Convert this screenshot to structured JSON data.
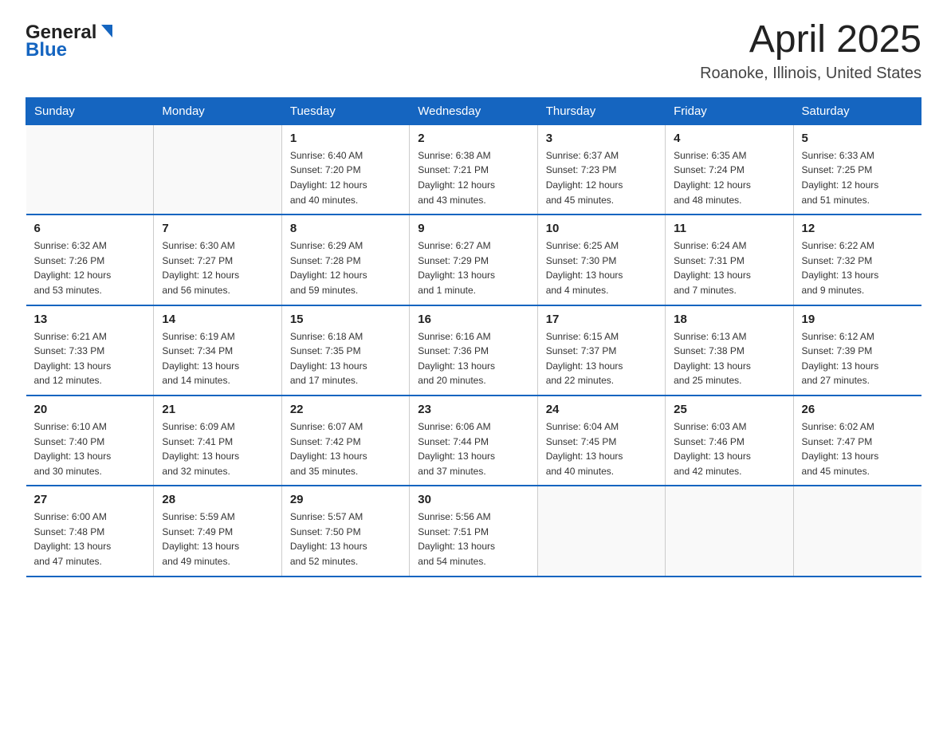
{
  "logo": {
    "general": "General",
    "blue": "Blue"
  },
  "title": "April 2025",
  "location": "Roanoke, Illinois, United States",
  "days_of_week": [
    "Sunday",
    "Monday",
    "Tuesday",
    "Wednesday",
    "Thursday",
    "Friday",
    "Saturday"
  ],
  "weeks": [
    [
      {
        "day": "",
        "info": ""
      },
      {
        "day": "",
        "info": ""
      },
      {
        "day": "1",
        "info": "Sunrise: 6:40 AM\nSunset: 7:20 PM\nDaylight: 12 hours\nand 40 minutes."
      },
      {
        "day": "2",
        "info": "Sunrise: 6:38 AM\nSunset: 7:21 PM\nDaylight: 12 hours\nand 43 minutes."
      },
      {
        "day": "3",
        "info": "Sunrise: 6:37 AM\nSunset: 7:23 PM\nDaylight: 12 hours\nand 45 minutes."
      },
      {
        "day": "4",
        "info": "Sunrise: 6:35 AM\nSunset: 7:24 PM\nDaylight: 12 hours\nand 48 minutes."
      },
      {
        "day": "5",
        "info": "Sunrise: 6:33 AM\nSunset: 7:25 PM\nDaylight: 12 hours\nand 51 minutes."
      }
    ],
    [
      {
        "day": "6",
        "info": "Sunrise: 6:32 AM\nSunset: 7:26 PM\nDaylight: 12 hours\nand 53 minutes."
      },
      {
        "day": "7",
        "info": "Sunrise: 6:30 AM\nSunset: 7:27 PM\nDaylight: 12 hours\nand 56 minutes."
      },
      {
        "day": "8",
        "info": "Sunrise: 6:29 AM\nSunset: 7:28 PM\nDaylight: 12 hours\nand 59 minutes."
      },
      {
        "day": "9",
        "info": "Sunrise: 6:27 AM\nSunset: 7:29 PM\nDaylight: 13 hours\nand 1 minute."
      },
      {
        "day": "10",
        "info": "Sunrise: 6:25 AM\nSunset: 7:30 PM\nDaylight: 13 hours\nand 4 minutes."
      },
      {
        "day": "11",
        "info": "Sunrise: 6:24 AM\nSunset: 7:31 PM\nDaylight: 13 hours\nand 7 minutes."
      },
      {
        "day": "12",
        "info": "Sunrise: 6:22 AM\nSunset: 7:32 PM\nDaylight: 13 hours\nand 9 minutes."
      }
    ],
    [
      {
        "day": "13",
        "info": "Sunrise: 6:21 AM\nSunset: 7:33 PM\nDaylight: 13 hours\nand 12 minutes."
      },
      {
        "day": "14",
        "info": "Sunrise: 6:19 AM\nSunset: 7:34 PM\nDaylight: 13 hours\nand 14 minutes."
      },
      {
        "day": "15",
        "info": "Sunrise: 6:18 AM\nSunset: 7:35 PM\nDaylight: 13 hours\nand 17 minutes."
      },
      {
        "day": "16",
        "info": "Sunrise: 6:16 AM\nSunset: 7:36 PM\nDaylight: 13 hours\nand 20 minutes."
      },
      {
        "day": "17",
        "info": "Sunrise: 6:15 AM\nSunset: 7:37 PM\nDaylight: 13 hours\nand 22 minutes."
      },
      {
        "day": "18",
        "info": "Sunrise: 6:13 AM\nSunset: 7:38 PM\nDaylight: 13 hours\nand 25 minutes."
      },
      {
        "day": "19",
        "info": "Sunrise: 6:12 AM\nSunset: 7:39 PM\nDaylight: 13 hours\nand 27 minutes."
      }
    ],
    [
      {
        "day": "20",
        "info": "Sunrise: 6:10 AM\nSunset: 7:40 PM\nDaylight: 13 hours\nand 30 minutes."
      },
      {
        "day": "21",
        "info": "Sunrise: 6:09 AM\nSunset: 7:41 PM\nDaylight: 13 hours\nand 32 minutes."
      },
      {
        "day": "22",
        "info": "Sunrise: 6:07 AM\nSunset: 7:42 PM\nDaylight: 13 hours\nand 35 minutes."
      },
      {
        "day": "23",
        "info": "Sunrise: 6:06 AM\nSunset: 7:44 PM\nDaylight: 13 hours\nand 37 minutes."
      },
      {
        "day": "24",
        "info": "Sunrise: 6:04 AM\nSunset: 7:45 PM\nDaylight: 13 hours\nand 40 minutes."
      },
      {
        "day": "25",
        "info": "Sunrise: 6:03 AM\nSunset: 7:46 PM\nDaylight: 13 hours\nand 42 minutes."
      },
      {
        "day": "26",
        "info": "Sunrise: 6:02 AM\nSunset: 7:47 PM\nDaylight: 13 hours\nand 45 minutes."
      }
    ],
    [
      {
        "day": "27",
        "info": "Sunrise: 6:00 AM\nSunset: 7:48 PM\nDaylight: 13 hours\nand 47 minutes."
      },
      {
        "day": "28",
        "info": "Sunrise: 5:59 AM\nSunset: 7:49 PM\nDaylight: 13 hours\nand 49 minutes."
      },
      {
        "day": "29",
        "info": "Sunrise: 5:57 AM\nSunset: 7:50 PM\nDaylight: 13 hours\nand 52 minutes."
      },
      {
        "day": "30",
        "info": "Sunrise: 5:56 AM\nSunset: 7:51 PM\nDaylight: 13 hours\nand 54 minutes."
      },
      {
        "day": "",
        "info": ""
      },
      {
        "day": "",
        "info": ""
      },
      {
        "day": "",
        "info": ""
      }
    ]
  ]
}
